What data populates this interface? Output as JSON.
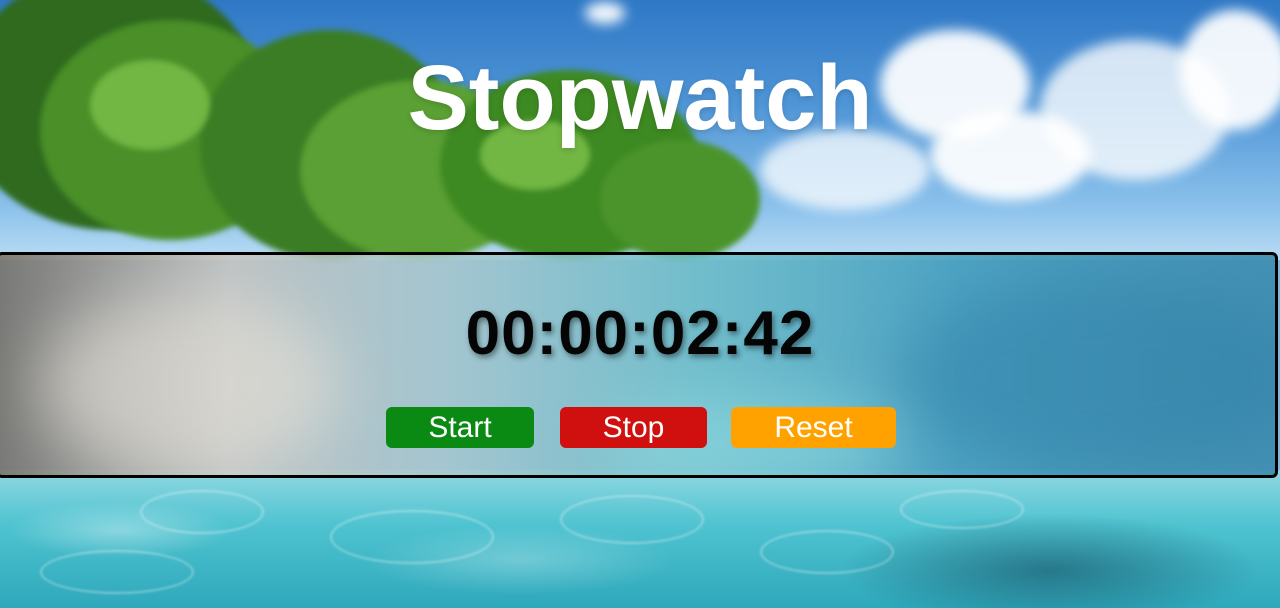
{
  "page": {
    "title": "Stopwatch"
  },
  "stopwatch": {
    "display": "00:00:02:42"
  },
  "controls": {
    "start_label": "Start",
    "stop_label": "Stop",
    "reset_label": "Reset"
  },
  "colors": {
    "start": "#0a8a12",
    "stop": "#d00f0f",
    "reset": "#ffa200",
    "title_text": "#ffffff",
    "timer_text": "#050505"
  }
}
